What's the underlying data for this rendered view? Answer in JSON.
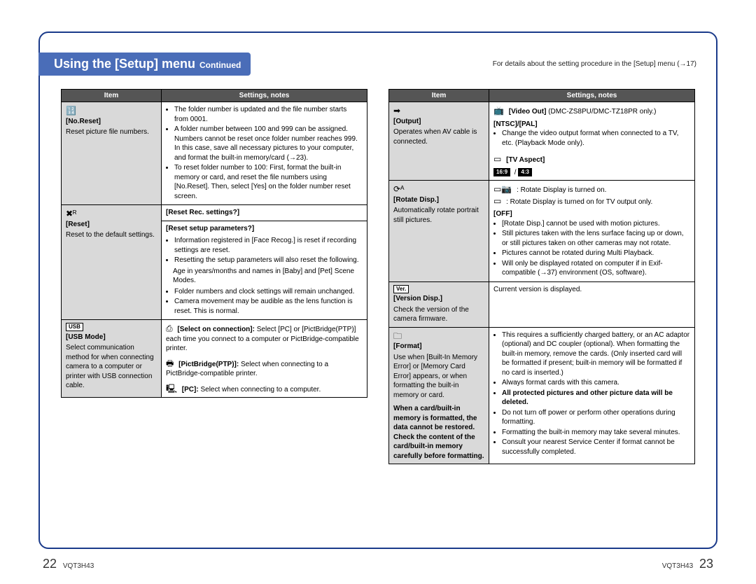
{
  "header": {
    "title_main": "Using the [Setup] menu",
    "title_sub": "Continued",
    "note": "For details about the setting procedure in the [Setup] menu (→17)"
  },
  "col_headers": {
    "item": "Item",
    "settings": "Settings, notes"
  },
  "left": [
    {
      "icon": "no-reset-icon",
      "title": "[No.Reset]",
      "desc": "Reset picture file numbers.",
      "blocks": [
        {
          "bullets": [
            "The folder number is updated and the file number starts from 0001.",
            "A folder number between 100 and 999 can be assigned. Numbers cannot be reset once folder number reaches 999. In this case, save all necessary pictures to your computer, and format the built-in memory/card (→23).",
            "To reset folder number to 100: First, format the built-in memory or card, and reset the file numbers using [No.Reset]. Then, select [Yes] on the folder number reset screen."
          ]
        }
      ]
    },
    {
      "icon": "reset-icon",
      "title": "[Reset]",
      "desc": "Reset to the default settings.",
      "blocks": [
        {
          "subhead": "[Reset Rec. settings?]"
        },
        {
          "subhead": "[Reset setup parameters?]",
          "bullets": [
            "Information registered in [Face Recog.] is reset if recording settings are reset.",
            "Resetting the setup parameters will also reset the following."
          ],
          "plain": "Age in years/months and names in [Baby] and [Pet] Scene Modes.",
          "bullets2": [
            "Folder numbers and clock settings will remain unchanged.",
            "Camera movement may be audible as the lens function is reset. This is normal."
          ]
        }
      ]
    },
    {
      "icon": "usb-icon",
      "title": "[USB Mode]",
      "desc": "Select communication method for when connecting camera to a computer or printer with USB connection cable.",
      "blocks": [
        {
          "lines": [
            {
              "icon": "select-icon",
              "b": "[Select on connection]:",
              "t": " Select [PC] or [PictBridge(PTP)] each time you connect to a computer or PictBridge-compatible printer."
            },
            {
              "icon": "printer-icon",
              "b": "[PictBridge(PTP)]:",
              "t": " Select when connecting to a PictBridge-compatible printer."
            },
            {
              "icon": "pc-icon",
              "b": "[PC]:",
              "t": " Select when connecting to a computer."
            }
          ]
        }
      ]
    }
  ],
  "right": [
    {
      "icon": "output-icon",
      "title": "[Output]",
      "desc": "Operates when AV cable is connected.",
      "blocks": [
        {
          "lead_icon": "video-out-icon",
          "lead_b": "[Video Out]",
          "lead_t": " (DMC-ZS8PU/DMC-TZ18PR only.)",
          "subhead_b": "[NTSC]/[PAL]",
          "bullets": [
            "Change the video output format when connected to a TV, etc. (Playback Mode only)."
          ],
          "tail_icon": "tv-aspect-icon",
          "tail_b": "[TV Aspect]",
          "aspect": {
            "a": "16:9",
            "b": "4:3"
          }
        }
      ]
    },
    {
      "icon": "rotate-icon",
      "title": "[Rotate Disp.]",
      "desc": "Automatically rotate portrait still pictures.",
      "blocks": [
        {
          "lines": [
            {
              "icon": "rotate-on-icon",
              "b": "",
              "t": ": Rotate Display is turned on."
            },
            {
              "icon": "rotate-tv-icon",
              "b": "",
              "t": ": Rotate Display is turned on for TV output only."
            }
          ],
          "subhead_b": "[OFF]",
          "bullets": [
            "[Rotate Disp.] cannot be used with motion pictures.",
            "Still pictures taken with the lens surface facing up or down, or still pictures taken on other cameras may not rotate.",
            "Pictures cannot be rotated during Multi Playback.",
            "Will only be displayed rotated on computer if in Exif-compatible (→37) environment (OS, software)."
          ]
        }
      ]
    },
    {
      "icon": "version-icon",
      "title": "[Version Disp.]",
      "desc": "Check the version of the camera firmware.",
      "blocks": [
        {
          "plain_only": "Current version is displayed."
        }
      ]
    },
    {
      "icon": "format-icon",
      "title": "[Format]",
      "desc": "Use when [Built-In Memory Error] or [Memory Card Error] appears, or when formatting the built-in memory or card.",
      "desc_bold": "When a card/built-in memory is formatted, the data cannot be restored. Check the content of the card/built-in memory carefully before formatting.",
      "blocks": [
        {
          "bullets": [
            "This requires a sufficiently charged battery, or an AC adaptor (optional) and DC coupler (optional). When formatting the built-in memory, remove the cards. (Only inserted card will be formatted if present; built-in memory will be formatted if no card is inserted.)",
            "Always format cards with this camera."
          ],
          "bold_bullet": "All protected pictures and other picture data will be deleted.",
          "bullets2": [
            "Do not turn off power or perform other operations during formatting.",
            "Formatting the built-in memory may take several minutes.",
            "Consult your nearest Service Center if format cannot be successfully completed."
          ]
        }
      ]
    }
  ],
  "footer": {
    "left_num": "22",
    "code": "VQT3H43",
    "right_num": "23"
  }
}
